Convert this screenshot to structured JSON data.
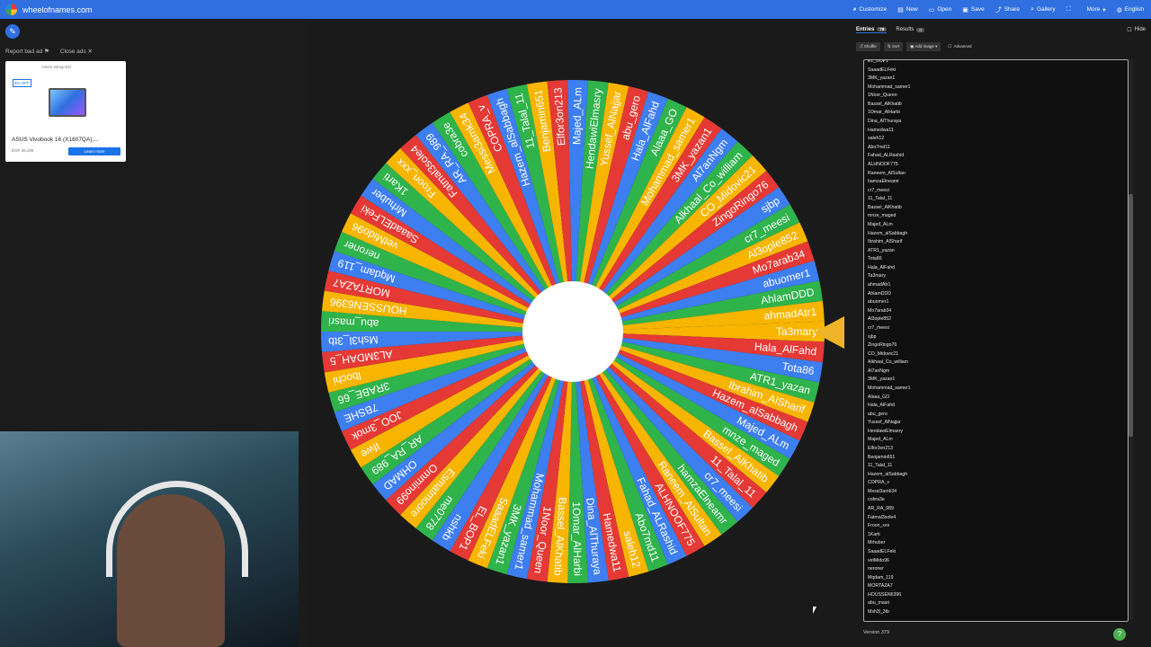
{
  "app": {
    "title": "wheelofnames.com"
  },
  "toolbar": {
    "items": [
      {
        "label": "Customize",
        "icon": "palette-icon"
      },
      {
        "label": "New",
        "icon": "new-file-icon"
      },
      {
        "label": "Open",
        "icon": "folder-open-icon"
      },
      {
        "label": "Save",
        "icon": "save-icon"
      },
      {
        "label": "Share",
        "icon": "share-icon"
      },
      {
        "label": "Gallery",
        "icon": "search-icon"
      },
      {
        "label": "",
        "icon": "fullscreen-icon"
      },
      {
        "label": "More",
        "icon": "chevron-down-icon"
      },
      {
        "label": "English",
        "icon": "globe-icon"
      }
    ]
  },
  "ads": {
    "report": "Report bad ad",
    "close": "Close ads",
    "product": "ASUS Vivobook 16 (X1607QA);...",
    "cta": "Learn more",
    "sale": "5% OFF",
    "price": "EGP 36,299",
    "brand": "ASUS eshop EG"
  },
  "tabs": {
    "entries": "Entries",
    "entries_count": "78",
    "results": "Results",
    "results_count": "0",
    "hide": "Hide"
  },
  "buttons": {
    "shuffle": "Shuffle",
    "sort": "Sort",
    "add_image": "Add image",
    "advanced": "Advanced"
  },
  "entries": [
    "EL_BOP1",
    "SaaadELFeki",
    "3MK_yazan1",
    "Mohammad_samer1",
    "1Noor_Queen",
    "Bassel_AlKhatib",
    "1Omar_AlHarbi",
    "Dina_AlThuraya",
    "Hamedwa11",
    "saleh12",
    "Abo7md11",
    "Fahad_ALRashid",
    "ALHNOOF775",
    "Raneem_AlSultan",
    "hamzaElneamr",
    "cr7_meesi",
    "11_Talal_11",
    "Bassel_AlKhatib",
    "mnze_maged",
    "Majed_ALm",
    "Hazem_alSabbagh",
    "Ibrahim_AlSharif",
    "ATR1_yazan",
    "Tota86",
    "Hala_AlFahd",
    "Ta3mary",
    "ahmadAtr1",
    "AhlamDDD",
    "abuomer1",
    "Mo7arab34",
    "Al3ople852",
    "cr7_meesi",
    "sjbp",
    "ZingoRingo76",
    "CO_Midovic21",
    "Alkhaal_Co_william",
    "Al7anNgm",
    "3MK_yazan1",
    "Mohammad_samer1",
    "Alaaa_GO",
    "Hala_AlFahd",
    "abu_gero",
    "Yussef_AlNajjar",
    "HendawiElmasry",
    "Majed_ALm",
    "Elfor3on213",
    "Benjamin651",
    "11_Talal_11",
    "Hazem_alSabbagh",
    "COPRA_v",
    "Messi3amk34",
    "cobra3e",
    "AR_RA_989",
    "Fatmal3sole4",
    "Froon_xxx",
    "1Karti",
    "Mrhuber",
    "SaaadELFeki",
    "vetMido96",
    "neroner",
    "Mqdam_119",
    "MORTAZA7",
    "HOUSSEN6396",
    "abu_masri",
    "Msh3l_3tb"
  ],
  "wheel_names": [
    "Ta3mary",
    "Hala_AlFahd",
    "Tota86",
    "ATR1_yazan",
    "Ibrahim_AlSharif",
    "Hazem_alSabbagh",
    "Majed_ALm",
    "mnze_maged",
    "Bassel_AlKhatib",
    "11_Talal_11",
    "cr7_meesi",
    "hamzaElneamr",
    "Raneem_AlSultan",
    "ALHNOOF775",
    "Fahad_ALRashid",
    "Abo7md11",
    "saleh12",
    "Hamedwa11",
    "Dina_AlThuraya",
    "1Omar_AlHarbi",
    "Bassel_AlKhatib",
    "1Noor_Queen",
    "Mohammad_samer1",
    "3MK_yazan1",
    "SaaadELFeki",
    "EL_BOP1",
    "nshkb",
    "me0778",
    "Esmatmoore",
    "Ommino99",
    "OHMAD",
    "AR_RA_989",
    "Ifwe",
    "JOO_3mok",
    "7BSHE",
    "3RABE_66",
    "lbochi",
    "AL3MDAH_5",
    "Msh3l_3tb",
    "abu_masri",
    "HOUSSEN6396",
    "MORTAZA7",
    "Mqdam_119",
    "neroner",
    "vetMido96",
    "SaaadELFeki",
    "Mrhuber",
    "1Karti",
    "Froon_xxx",
    "Fatmal3sole4",
    "AR_RA_989",
    "cobra3e",
    "Messi3amk34",
    "COPRA_v",
    "Hazem_alSabbagh",
    "11_Talal_11",
    "Benjamin651",
    "Elfor3on213",
    "Majed_ALm",
    "HendawiElmasry",
    "Yussef_AlNajjar",
    "abu_gero",
    "Hala_AlFahd",
    "Alaaa_GO",
    "Mohammad_samer1",
    "3MK_yazan1",
    "Al7anNgm",
    "Alkhaal_Co_william",
    "CO_Midovic21",
    "ZingoRingo76",
    "sjbp",
    "cr7_meesi",
    "Al3ople852",
    "Mo7arab34",
    "abuomer1",
    "AhlamDDD",
    "ahmadAtr1"
  ],
  "wheel_colors": [
    "#f7b500",
    "#e53935",
    "#3d7ef0",
    "#2fb34b"
  ],
  "version": "Version 379"
}
